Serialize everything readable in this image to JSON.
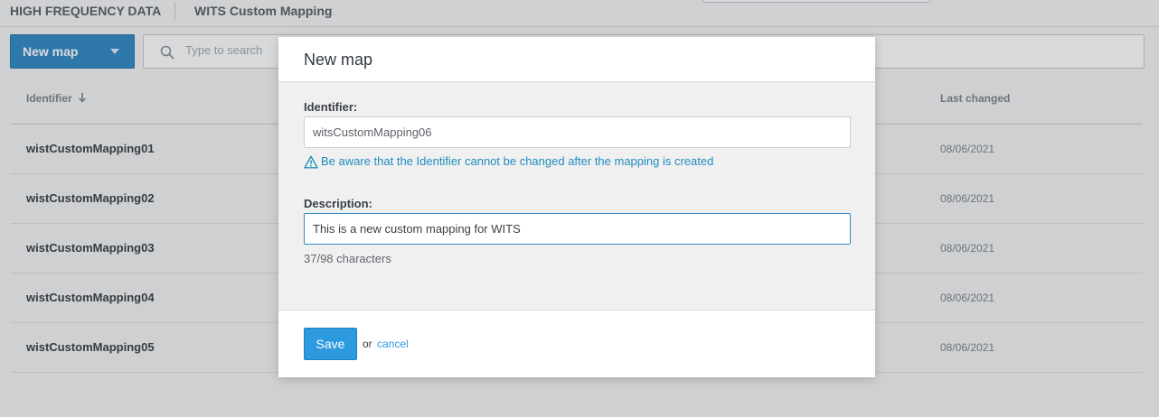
{
  "topbar": {
    "tabs": [
      {
        "label": "HIGH FREQUENCY DATA"
      },
      {
        "label": "WITS Custom Mapping"
      }
    ]
  },
  "toolbar": {
    "new_map_label": "New map",
    "search_placeholder": "Type to search"
  },
  "table": {
    "columns": {
      "identifier": "Identifier",
      "identifier_sort_icon": "arrow-down-icon",
      "last_changed": "Last changed"
    },
    "rows": [
      {
        "identifier": "wistCustomMapping01",
        "last_changed": "08/06/2021"
      },
      {
        "identifier": "wistCustomMapping02",
        "last_changed": "08/06/2021"
      },
      {
        "identifier": "wistCustomMapping03",
        "last_changed": "08/06/2021"
      },
      {
        "identifier": "wistCustomMapping04",
        "last_changed": "08/06/2021"
      },
      {
        "identifier": "wistCustomMapping05",
        "last_changed": "08/06/2021"
      }
    ]
  },
  "modal": {
    "title": "New map",
    "identifier_label": "Identifier:",
    "identifier_value": "witsCustomMapping06",
    "warning_text": "Be aware that the Identifier cannot be changed after the mapping is created",
    "warning_icon": "warning-triangle-icon",
    "description_label": "Description:",
    "description_value": "This is a new custom mapping for WITS",
    "char_count": "37/98 characters",
    "save_label": "Save",
    "or_text": "or",
    "cancel_label": "cancel"
  },
  "colors": {
    "primary": "#3189c6",
    "save": "#2d9ae0",
    "warning": "#1f8dbd"
  }
}
